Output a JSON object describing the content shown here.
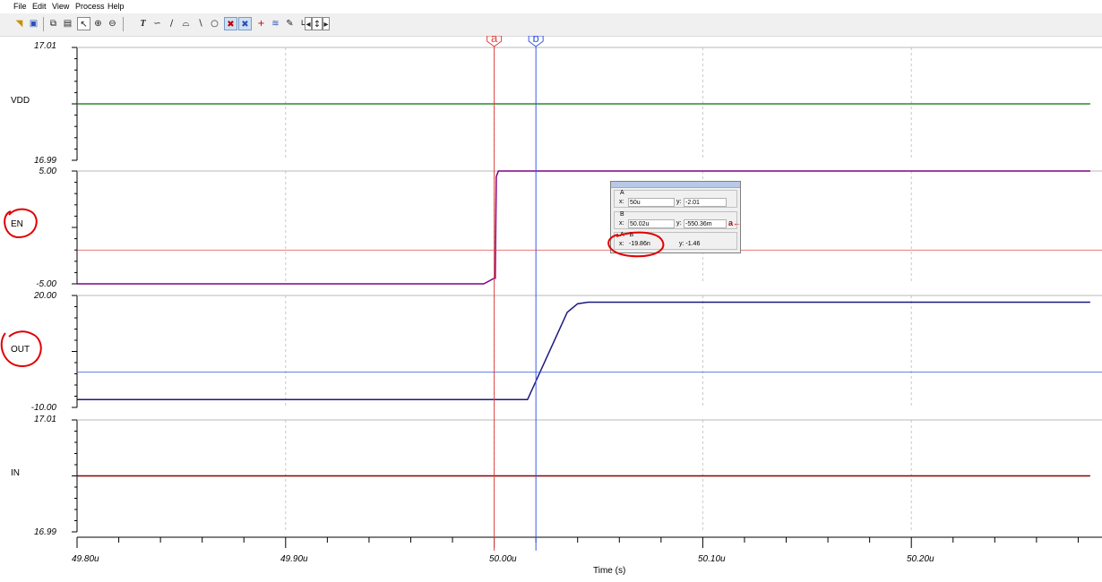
{
  "menu": [
    "File",
    "Edit",
    "View",
    "Process",
    "Help"
  ],
  "toolbar_icons": [
    "open-folder-icon",
    "save-icon",
    "copy-icon",
    "paste-icon",
    "pointer-icon",
    "zoom-in-icon",
    "zoom-out-icon",
    "text-icon",
    "curve-tool-icon",
    "slope-tool-icon",
    "measure-tool-icon",
    "line-tool-icon",
    "ellipse-tool-icon",
    "cursor-a-icon",
    "cursor-b-icon",
    "add-marker-icon",
    "fit-icon",
    "pen-icon",
    "polyline-icon",
    "move-left-icon",
    "move-up-down-icon",
    "move-right-icon"
  ],
  "cursors": {
    "a_label": "a",
    "b_label": "b",
    "a_color": "#e04040",
    "b_color": "#3a5ae0"
  },
  "panels": [
    {
      "name": "VDD",
      "color": "#2b8a2b",
      "y_top": "17.01",
      "y_bottom": "16.99"
    },
    {
      "name": "EN",
      "color": "#800080",
      "y_top": "5.00",
      "y_bottom": "-5.00"
    },
    {
      "name": "OUT",
      "color": "#1a1a80",
      "y_top": "20.00",
      "y_bottom": "-10.00"
    },
    {
      "name": "IN",
      "color": "#8b0000",
      "y_top": "17.01",
      "y_bottom": "16.99"
    }
  ],
  "x_ticks": [
    "49.80u",
    "49.90u",
    "50.00u",
    "50.10u",
    "50.20u"
  ],
  "x_axis_title": "Time (s)",
  "chart_data": {
    "type": "line",
    "xlabel": "Time (s)",
    "xlim": [
      49.8,
      50.2858
    ],
    "x_unit": "u",
    "series": [
      {
        "name": "VDD",
        "x": [
          49.8,
          50.2858
        ],
        "y": [
          17.0,
          17.0
        ],
        "ylim": [
          16.99,
          17.01
        ]
      },
      {
        "name": "EN",
        "x": [
          49.8,
          49.995,
          50.0,
          50.0005,
          50.001,
          50.002,
          50.2858
        ],
        "y": [
          -5.0,
          -5.0,
          -4.5,
          -4.5,
          4.5,
          5.0,
          5.0
        ],
        "ylim": [
          -5.0,
          5.0
        ]
      },
      {
        "name": "OUT",
        "x": [
          49.8,
          50.016,
          50.035,
          50.04,
          50.045,
          50.2858
        ],
        "y": [
          -7.9,
          -7.9,
          15.5,
          17.8,
          18.2,
          18.2
        ],
        "ylim": [
          -10.0,
          20.0
        ]
      },
      {
        "name": "IN",
        "x": [
          49.8,
          50.2858
        ],
        "y": [
          17.0,
          17.0
        ],
        "ylim": [
          16.99,
          17.01
        ]
      }
    ],
    "cursor_a_x": 50.0,
    "cursor_b_x": 50.02,
    "cursor_a_level": -2.01,
    "cursor_b_level": -0.55036
  },
  "cursor_panel": {
    "a_title": "A",
    "a_x": "50u",
    "a_y": "-2.01",
    "b_title": "B",
    "b_x": "50.02u",
    "b_y": "-550.36m",
    "b_button": "a",
    "diff_title": "A - B",
    "diff_x": "-19.86n",
    "diff_y": "y: -1.46",
    "x_label": "x:",
    "y_label": "y:"
  }
}
